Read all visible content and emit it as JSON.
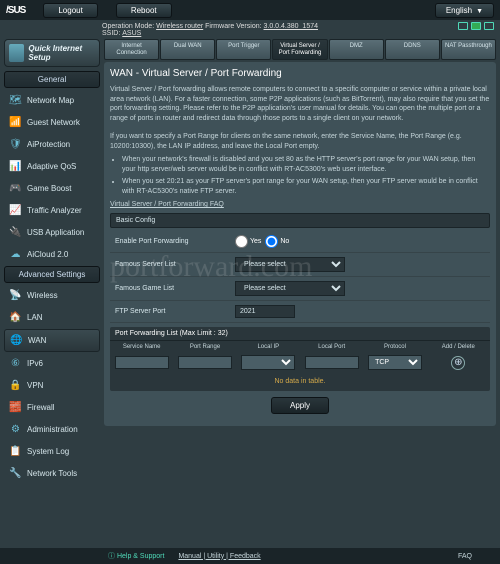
{
  "top": {
    "logo": "/SUS",
    "logout": "Logout",
    "reboot": "Reboot",
    "lang": "English"
  },
  "info": {
    "opmode_lbl": "Operation Mode:",
    "opmode": "Wireless router",
    "fw_lbl": "Firmware Version:",
    "fw": "3.0.0.4.380_1574",
    "ssid_lbl": "SSID:",
    "ssid": "ASUS"
  },
  "side": {
    "quick": "Quick Internet Setup",
    "g1": "General",
    "g2": "Advanced Settings",
    "items1": [
      "Network Map",
      "Guest Network",
      "AiProtection",
      "Adaptive QoS",
      "Game Boost",
      "Traffic Analyzer",
      "USB Application",
      "AiCloud 2.0"
    ],
    "items2": [
      "Wireless",
      "LAN",
      "WAN",
      "IPv6",
      "VPN",
      "Firewall",
      "Administration",
      "System Log",
      "Network Tools"
    ]
  },
  "tabs": [
    "Internet Connection",
    "Dual WAN",
    "Port Trigger",
    "Virtual Server / Port Forwarding",
    "DMZ",
    "DDNS",
    "NAT Passthrough"
  ],
  "title": "WAN - Virtual Server / Port Forwarding",
  "desc": {
    "p1": "Virtual Server / Port forwarding allows remote computers to connect to a specific computer or service within a private local area network (LAN). For a faster connection, some P2P applications (such as BitTorrent), may also require that you set the port forwarding setting. Please refer to the P2P application's user manual for details. You can open the multiple port or a range of ports in router and redirect data through those ports to a single client on your network.",
    "p2": "If you want to specify a Port Range for clients on the same network, enter the Service Name, the Port Range (e.g. 10200:10300), the LAN IP address, and leave the Local Port empty.",
    "b1": "When your network's firewall is disabled and you set 80 as the HTTP server's port range for your WAN setup, then your http server/web server would be in conflict with RT-AC5300's web user interface.",
    "b2": "When you set 20:21 as your FTP server's port range for your WAN setup, then your FTP server would be in conflict with RT-AC5300's native FTP server.",
    "faq": "Virtual Server / Port Forwarding FAQ"
  },
  "sec1": "Basic Config",
  "form": {
    "enable_lbl": "Enable Port Forwarding",
    "yes": "Yes",
    "no": "No",
    "fsl_lbl": "Famous Server List",
    "fsl": "Please select",
    "fgl_lbl": "Famous Game List",
    "fgl": "Please select",
    "ftp_lbl": "FTP Server Port",
    "ftp": "2021"
  },
  "pfl": {
    "hdr": "Port Forwarding List (Max Limit : 32)",
    "cols": [
      "Service Name",
      "Port Range",
      "Local IP",
      "Local Port",
      "Protocol",
      "Add / Delete"
    ],
    "proto": "TCP",
    "nodata": "No data in table."
  },
  "apply": "Apply",
  "foot": {
    "hs": "Help & Support",
    "mf": "Manual | Utility | Feedback",
    "faq": "FAQ"
  },
  "watermark": "portforward.com"
}
